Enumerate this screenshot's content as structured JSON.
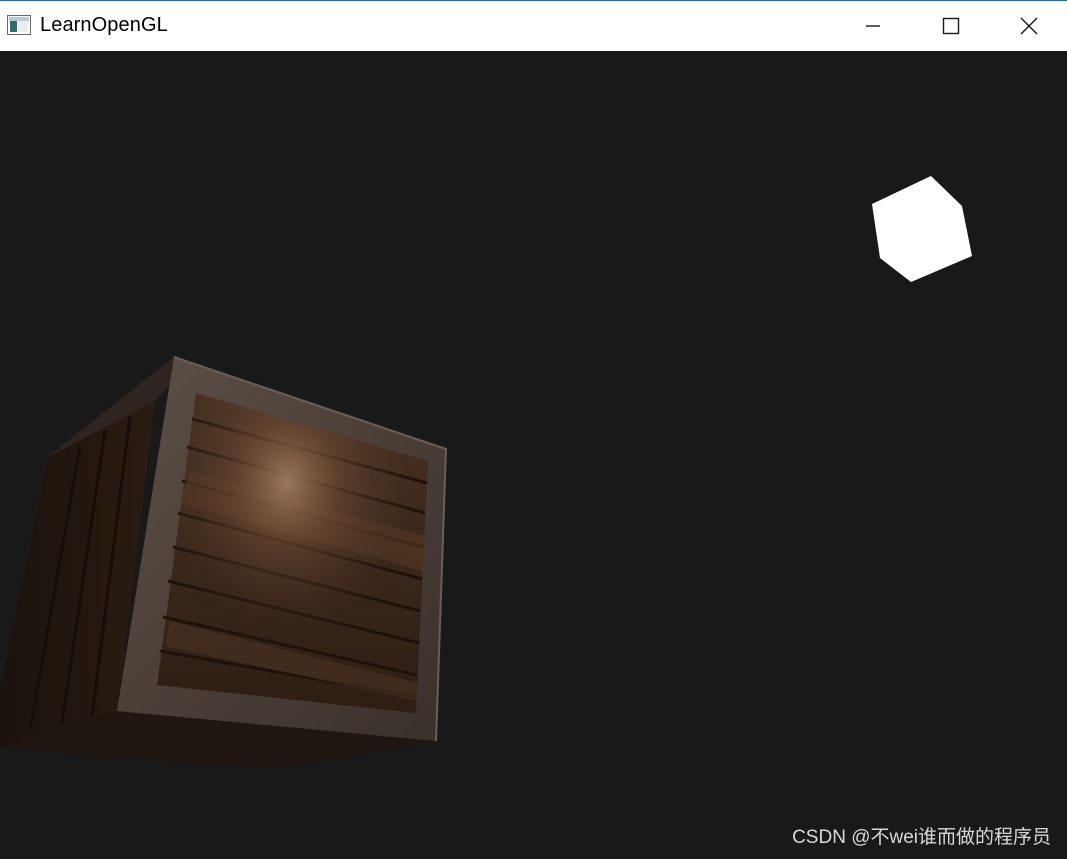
{
  "window": {
    "title": "LearnOpenGL",
    "controls": {
      "minimize": "minimize-icon",
      "maximize": "maximize-icon",
      "close": "close-icon"
    }
  },
  "scene": {
    "background_color": "#191919",
    "light_cube_color": "#ffffff",
    "crate": "wooden-crate"
  },
  "watermark": {
    "text": "CSDN @不wei谁而做的程序员"
  }
}
